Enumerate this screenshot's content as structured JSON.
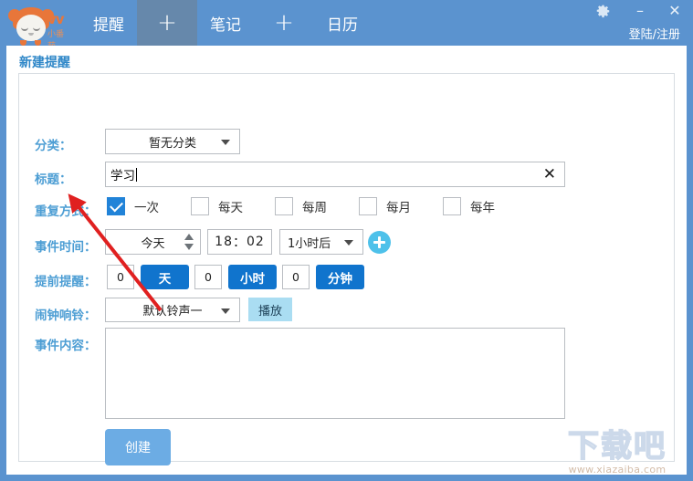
{
  "window": {
    "brand_name": "vv",
    "brand_sub": "小番茄",
    "tabs": [
      {
        "label": "提醒",
        "type": "word",
        "active": false
      },
      {
        "label": "+",
        "type": "plus",
        "active": true
      },
      {
        "label": "笔记",
        "type": "word",
        "active": false
      },
      {
        "label": "+",
        "type": "plus",
        "active": false
      },
      {
        "label": "日历",
        "type": "word",
        "active": false
      }
    ],
    "settings_icon": "gear-icon",
    "minimize_label": "–",
    "close_label": "✕",
    "login_label": "登陆/注册"
  },
  "panel": {
    "title": "新建提醒"
  },
  "form": {
    "category": {
      "label": "分类：",
      "value": "暂无分类"
    },
    "title_field": {
      "label": "标题：",
      "value": "学习",
      "clear_label": "✕"
    },
    "repeat": {
      "label": "重复方式：",
      "options": [
        {
          "label": "一次",
          "checked": true
        },
        {
          "label": "每天",
          "checked": false
        },
        {
          "label": "每周",
          "checked": false
        },
        {
          "label": "每月",
          "checked": false
        },
        {
          "label": "每年",
          "checked": false
        }
      ]
    },
    "event_time": {
      "label": "事件时间：",
      "day_value": "今天",
      "hour": "18",
      "separator": "：",
      "minute": "02",
      "offset_value": "1小时后",
      "add_button": "add-time-button"
    },
    "advance_notice": {
      "label": "提前提醒：",
      "days_value": "0",
      "days_unit": "天",
      "hours_value": "0",
      "hours_unit": "小时",
      "minutes_value": "0",
      "minutes_unit": "分钟"
    },
    "alarm": {
      "label": "闹钟响铃：",
      "ringtone": "默认铃声一",
      "play_label": "播放"
    },
    "content": {
      "label": "事件内容：",
      "value": ""
    },
    "submit": {
      "label": "创建"
    }
  },
  "watermark": {
    "text": "下载吧",
    "url": "www.xiazaiba.com"
  },
  "colors": {
    "titlebar": "#5b93cf",
    "tab_active": "#6688ab",
    "label_blue": "#4d9ed4",
    "panel_title_blue": "#2f87c8",
    "checkbox_checked": "#2183d8",
    "unit_button": "#1074cd",
    "play_button": "#aaddf2",
    "create_button": "#6cace4",
    "add_circle": "#4ec1ea",
    "annotation_arrow": "#e02020",
    "brand_orange": "#e8763a"
  }
}
